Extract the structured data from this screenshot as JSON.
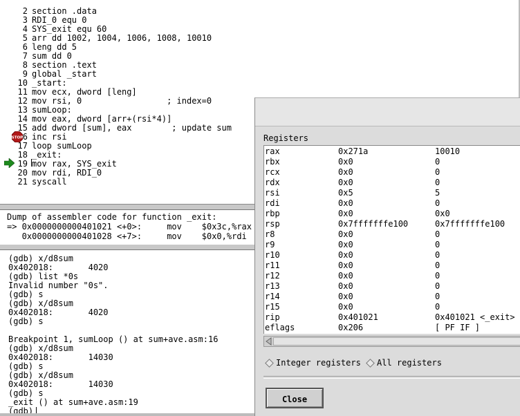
{
  "source": {
    "lines": [
      {
        "num": "2",
        "code": "section .data"
      },
      {
        "num": "3",
        "code": "RDI_0 equ 0"
      },
      {
        "num": "4",
        "code": "SYS_exit equ 60"
      },
      {
        "num": "5",
        "code": "arr dd 1002, 1004, 1006, 1008, 10010"
      },
      {
        "num": "6",
        "code": "leng dd 5"
      },
      {
        "num": "7",
        "code": "sum dd 0"
      },
      {
        "num": "8",
        "code": "section .text"
      },
      {
        "num": "9",
        "code": "global _start"
      },
      {
        "num": "10",
        "code": "_start:"
      },
      {
        "num": "11",
        "code": "mov ecx, dword [leng]"
      },
      {
        "num": "12",
        "code": "mov rsi, 0                 ; index=0"
      },
      {
        "num": "13",
        "code": "sumLoop:"
      },
      {
        "num": "14",
        "code": "mov eax, dword [arr+(rsi*4)]"
      },
      {
        "num": "15",
        "code": "add dword [sum], eax        ; update sum"
      },
      {
        "num": "6",
        "code": "inc rsi"
      },
      {
        "num": "17",
        "code": "loop sumLoop"
      },
      {
        "num": "18",
        "code": "_exit:"
      },
      {
        "num": "19",
        "code": "mov rax, SYS_exit"
      },
      {
        "num": "20",
        "code": "mov rdi, RDI_0"
      },
      {
        "num": "21",
        "code": "syscall"
      }
    ],
    "breakpoint_icon": "stop-sign-icon",
    "current_line_icon": "green-arrow-icon"
  },
  "assembler": {
    "lines": [
      "Dump of assembler code for function _exit:",
      "=> 0x0000000000401021 <+0>:     mov    $0x3c,%rax",
      "   0x0000000000401028 <+7>:     mov    $0x0,%rdi"
    ]
  },
  "console": {
    "lines": [
      "(gdb) x/d8sum",
      "0x402018:       4020",
      "(gdb) list *0s",
      "Invalid number \"0s\".",
      "(gdb) s",
      "(gdb) x/d8sum",
      "0x402018:       4020",
      "(gdb) s",
      "",
      "Breakpoint 1, sumLoop () at sum+ave.asm:16",
      "(gdb) x/d8sum",
      "0x402018:       14030",
      "(gdb) s",
      "(gdb) x/d8sum",
      "0x402018:       14030",
      "(gdb) s",
      "_exit () at sum+ave.asm:19"
    ],
    "prompt": "(gdb)"
  },
  "registers": {
    "title": "Registers",
    "rows": [
      {
        "name": "rax",
        "hex": "0x271a",
        "value": "10010"
      },
      {
        "name": "rbx",
        "hex": "0x0",
        "value": "0"
      },
      {
        "name": "rcx",
        "hex": "0x0",
        "value": "0"
      },
      {
        "name": "rdx",
        "hex": "0x0",
        "value": "0"
      },
      {
        "name": "rsi",
        "hex": "0x5",
        "value": "5"
      },
      {
        "name": "rdi",
        "hex": "0x0",
        "value": "0"
      },
      {
        "name": "rbp",
        "hex": "0x0",
        "value": "0x0"
      },
      {
        "name": "rsp",
        "hex": "0x7fffffffe100",
        "value": "0x7fffffffe100"
      },
      {
        "name": "r8",
        "hex": "0x0",
        "value": "0"
      },
      {
        "name": "r9",
        "hex": "0x0",
        "value": "0"
      },
      {
        "name": "r10",
        "hex": "0x0",
        "value": "0"
      },
      {
        "name": "r11",
        "hex": "0x0",
        "value": "0"
      },
      {
        "name": "r12",
        "hex": "0x0",
        "value": "0"
      },
      {
        "name": "r13",
        "hex": "0x0",
        "value": "0"
      },
      {
        "name": "r14",
        "hex": "0x0",
        "value": "0"
      },
      {
        "name": "r15",
        "hex": "0x0",
        "value": "0"
      },
      {
        "name": "rip",
        "hex": "0x401021",
        "value": "0x401021 <_exit>"
      },
      {
        "name": "eflags",
        "hex": "0x206",
        "value": "[ PF IF ]"
      }
    ],
    "options": {
      "integer_label": "Integer registers",
      "all_label": "All registers"
    },
    "close_label": "Close"
  },
  "colors": {
    "stop_red": "#b01818",
    "arrow_green": "#1e8a1e"
  }
}
